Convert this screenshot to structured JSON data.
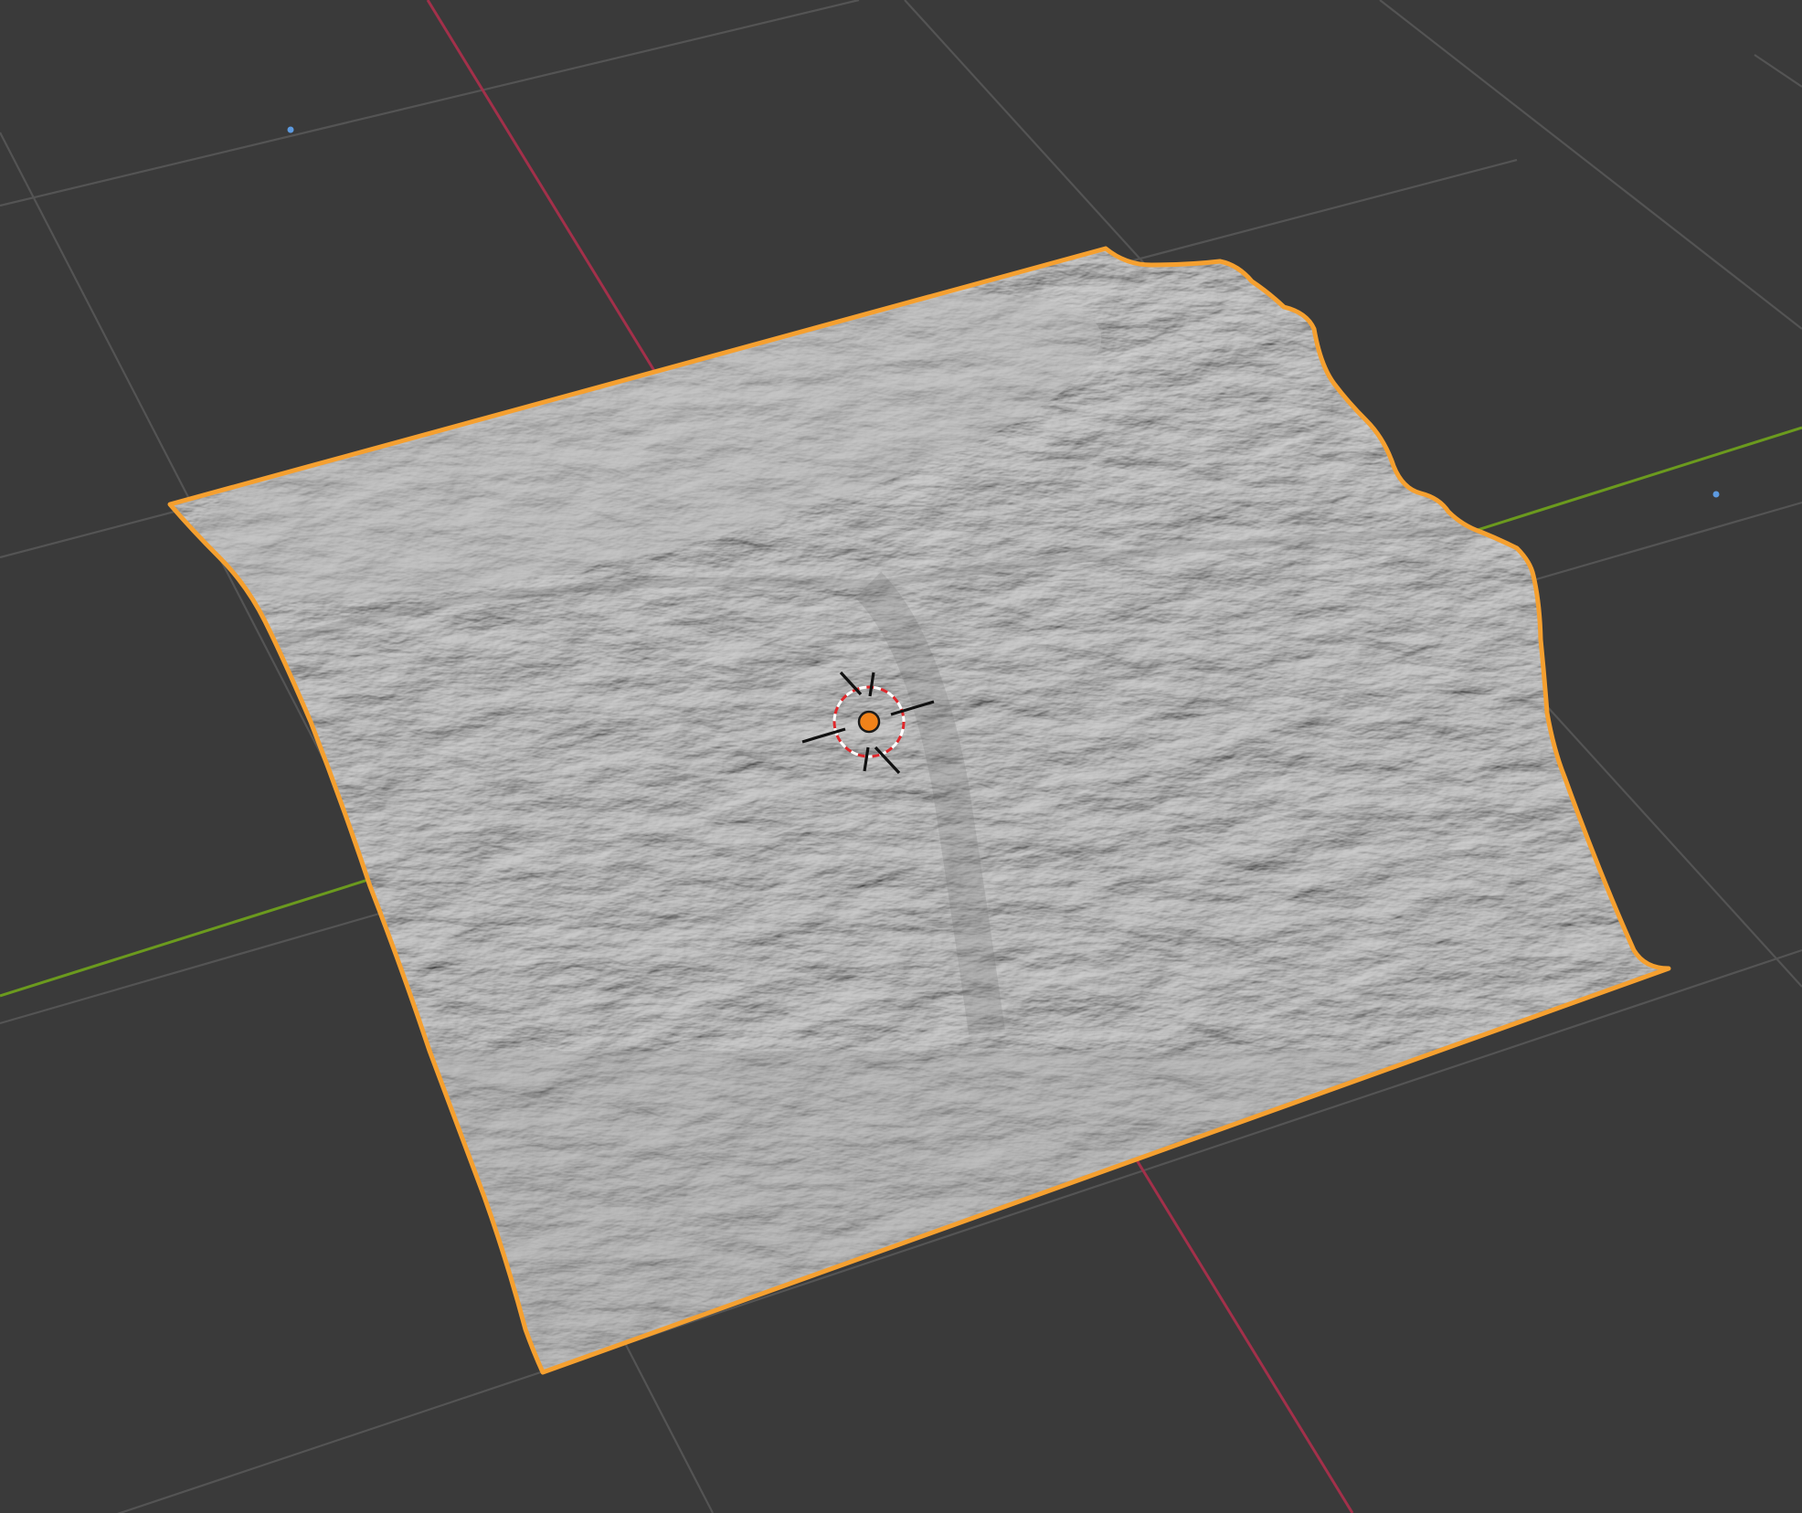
{
  "viewport": {
    "background": "#3a3a3a",
    "grid_color": "#545454",
    "x_axis_color": "#a2304a",
    "y_axis_color": "#6b9a1e"
  },
  "object": {
    "type": "terrain-mesh",
    "state": "selected",
    "selection_outline_color": "#f5a030",
    "surface_color": "#a9a9a9"
  },
  "cursor_3d": {
    "ring_colors": [
      "#e0262a",
      "#ffffff"
    ],
    "crosshair_color": "#111111"
  },
  "origin": {
    "color": "#f0821a"
  },
  "light_markers": {
    "color": "#5d9ae0"
  }
}
